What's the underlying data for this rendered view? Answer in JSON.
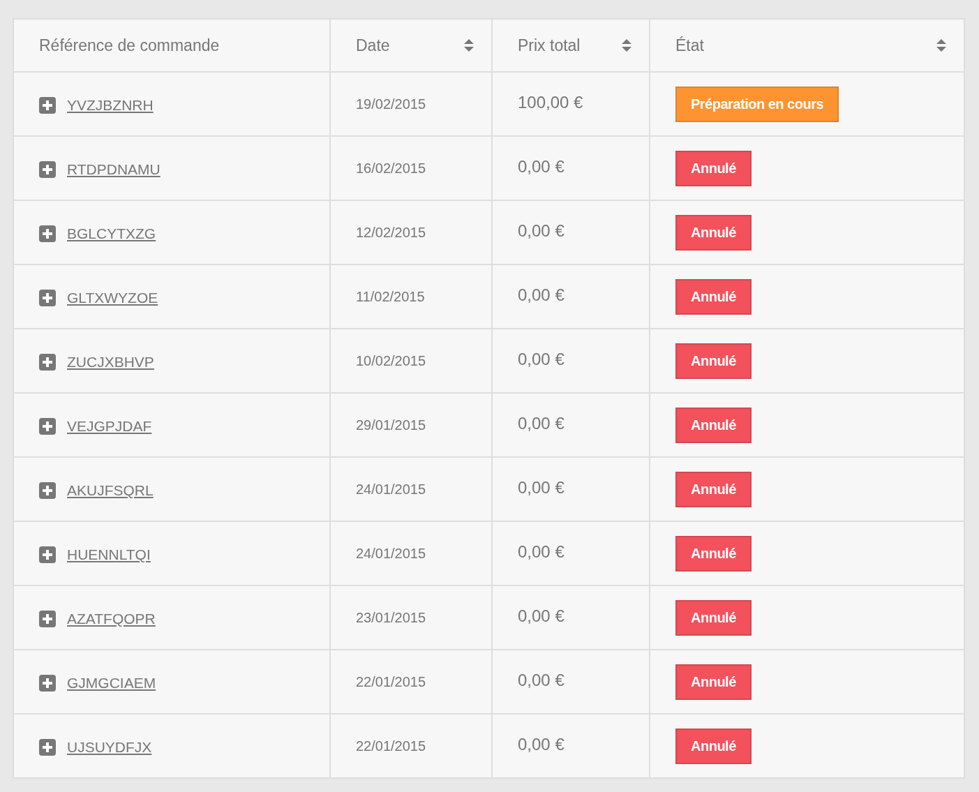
{
  "table": {
    "columns": [
      {
        "label": "Référence de commande",
        "sortable": false
      },
      {
        "label": "Date",
        "sortable": true
      },
      {
        "label": "Prix total",
        "sortable": true
      },
      {
        "label": "État",
        "sortable": true
      }
    ],
    "rows": [
      {
        "reference": "YVZJBZNRH",
        "date": "19/02/2015",
        "total": "100,00 €",
        "status": {
          "label": "Préparation en cours",
          "color": "#fe9431"
        }
      },
      {
        "reference": "RTDPDNAMU",
        "date": "16/02/2015",
        "total": "0,00 €",
        "status": {
          "label": "Annulé",
          "color": "#f3515c"
        }
      },
      {
        "reference": "BGLCYTXZG",
        "date": "12/02/2015",
        "total": "0,00 €",
        "status": {
          "label": "Annulé",
          "color": "#f3515c"
        }
      },
      {
        "reference": "GLTXWYZOE",
        "date": "11/02/2015",
        "total": "0,00 €",
        "status": {
          "label": "Annulé",
          "color": "#f3515c"
        }
      },
      {
        "reference": "ZUCJXBHVP",
        "date": "10/02/2015",
        "total": "0,00 €",
        "status": {
          "label": "Annulé",
          "color": "#f3515c"
        }
      },
      {
        "reference": "VEJGPJDAF",
        "date": "29/01/2015",
        "total": "0,00 €",
        "status": {
          "label": "Annulé",
          "color": "#f3515c"
        }
      },
      {
        "reference": "AKUJFSQRL",
        "date": "24/01/2015",
        "total": "0,00 €",
        "status": {
          "label": "Annulé",
          "color": "#f3515c"
        }
      },
      {
        "reference": "HUENNLTQI",
        "date": "24/01/2015",
        "total": "0,00 €",
        "status": {
          "label": "Annulé",
          "color": "#f3515c"
        }
      },
      {
        "reference": "AZATFQOPR",
        "date": "23/01/2015",
        "total": "0,00 €",
        "status": {
          "label": "Annulé",
          "color": "#f3515c"
        }
      },
      {
        "reference": "GJMGCIAEM",
        "date": "22/01/2015",
        "total": "0,00 €",
        "status": {
          "label": "Annulé",
          "color": "#f3515c"
        }
      },
      {
        "reference": "UJSUYDFJX",
        "date": "22/01/2015",
        "total": "0,00 €",
        "status": {
          "label": "Annulé",
          "color": "#f3515c"
        }
      }
    ]
  }
}
